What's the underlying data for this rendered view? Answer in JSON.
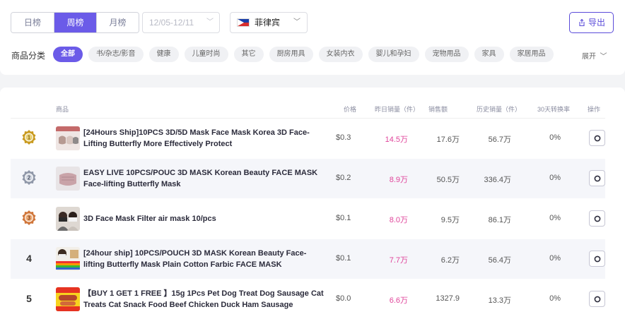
{
  "filters": {
    "periods": [
      "日榜",
      "周榜",
      "月榜"
    ],
    "active_period": "周榜",
    "date_range": "12/05-12/11",
    "country": "菲律宾",
    "export_label": "导出"
  },
  "categories": {
    "title": "商品分类",
    "items": [
      "全部",
      "书/杂志/影音",
      "健康",
      "儿童时尚",
      "其它",
      "厨房用具",
      "女装内衣",
      "婴儿和孕妇",
      "宠物用品",
      "家具",
      "家居用品"
    ],
    "active": "全部",
    "expand_label": "展开"
  },
  "table": {
    "headers": {
      "product": "商品",
      "price": "价格",
      "yesterday_sales": "昨日销量（件）",
      "sales_amount": "销售额",
      "history_sales": "历史销量（件）",
      "conversion_30d": "30天转换率",
      "action": "操作"
    },
    "rows": [
      {
        "rank": "1",
        "title": "[24Hours Ship]10PCS 3D/5D Mask Face Mask Korea 3D Face-Lifting Butterfly More Effectively Protect",
        "price": "$0.3",
        "yesterday": "14.5万",
        "amount": "17.6万",
        "history": "56.7万",
        "rate": "0%"
      },
      {
        "rank": "2",
        "title": "EASY LIVE 10PCS/POUC 3D MASK Korean Beauty FACE MASK Face-lifting Butterfly Mask",
        "price": "$0.2",
        "yesterday": "8.9万",
        "amount": "50.5万",
        "history": "336.4万",
        "rate": "0%"
      },
      {
        "rank": "3",
        "title": "3D Face Mask Filter air mask 10/pcs",
        "price": "$0.1",
        "yesterday": "8.0万",
        "amount": "9.5万",
        "history": "86.1万",
        "rate": "0%"
      },
      {
        "rank": "4",
        "title": "[24hour ship] 10PCS/POUCH 3D MASK Korean Beauty Face-lifting Butterfly Mask Plain Cotton Farbic FACE MASK",
        "price": "$0.1",
        "yesterday": "7.7万",
        "amount": "6.2万",
        "history": "56.4万",
        "rate": "0%"
      },
      {
        "rank": "5",
        "title": "【BUY 1 GET 1 FREE 】15g 1Pcs Pet Dog Treat Dog Sausage Cat Treats Cat Snack Food Beef Chicken Duck Ham Sausage",
        "price": "$0.0",
        "yesterday": "6.6万",
        "amount": "1327.9",
        "history": "13.3万",
        "rate": "0%"
      }
    ]
  },
  "colors": {
    "accent": "#6b5be8",
    "sales_highlight": "#e0459b",
    "gold_medal": "#c99a1e",
    "silver_medal": "#8f97a8",
    "bronze_medal": "#d0763a"
  }
}
